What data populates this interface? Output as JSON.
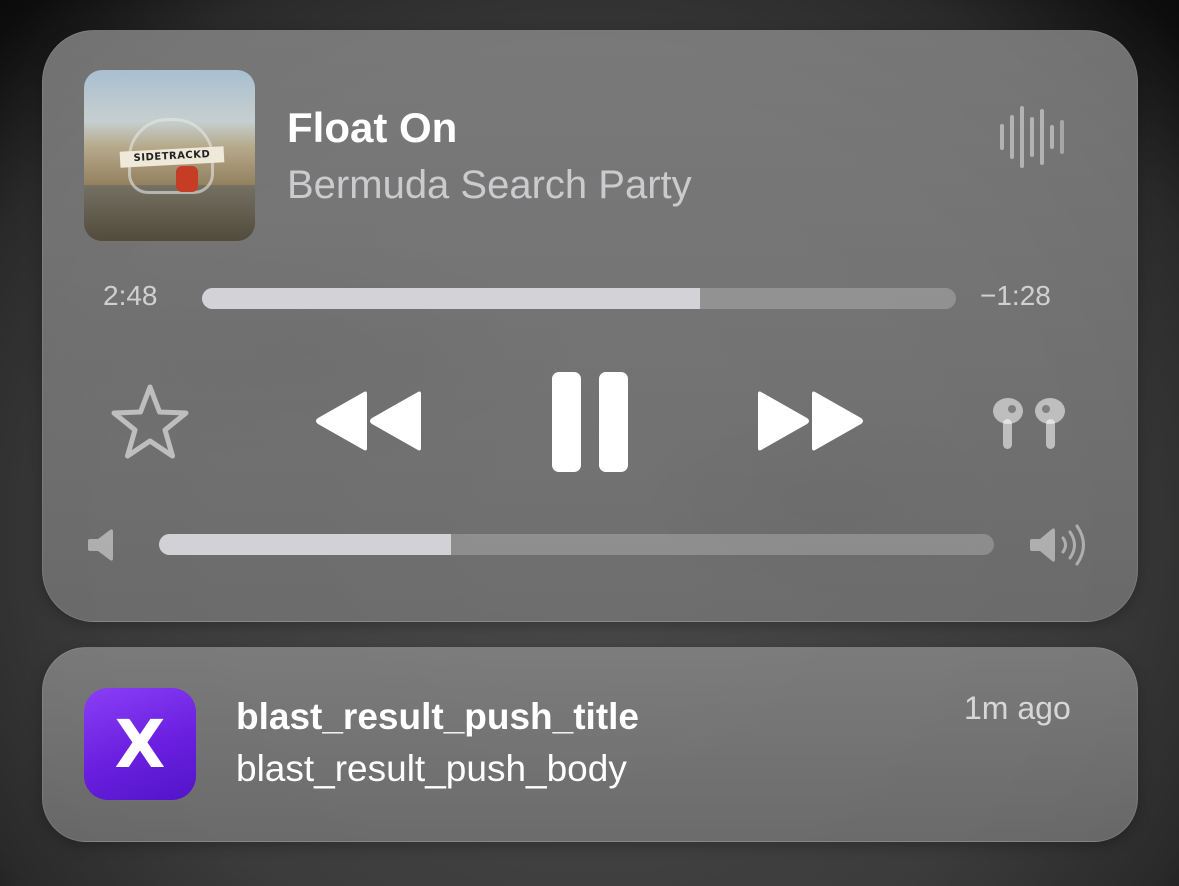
{
  "now_playing": {
    "album_art_text": "SIDETRACKD",
    "song_title": "Float On",
    "artist": "Bermuda Search Party",
    "elapsed": "2:48",
    "remaining": "−1:28",
    "progress_fraction": 0.66,
    "volume_fraction": 0.35,
    "icons": {
      "audio_wave": "waveform-icon",
      "favorite": "star-icon",
      "previous": "rewind-icon",
      "play_pause": "pause-icon",
      "next": "fast-forward-icon",
      "output": "airpods-icon",
      "volume_min": "speaker-low-icon",
      "volume_max": "speaker-high-icon"
    }
  },
  "notification": {
    "app_icon_letter": "X",
    "title": "blast_result_push_title",
    "body": "blast_result_push_body",
    "time": "1m ago",
    "app_color": "#6a1fe0"
  }
}
